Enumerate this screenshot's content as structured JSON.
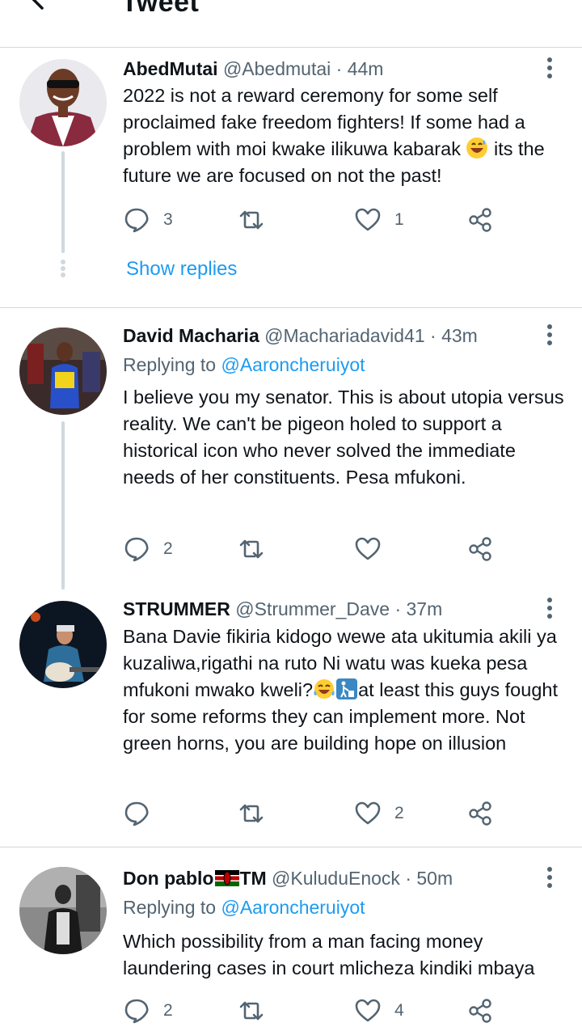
{
  "header": {
    "title": "Tweet",
    "back_icon": "arrow-left-icon"
  },
  "colors": {
    "link": "#1d9bf0",
    "secondary": "#536471",
    "divider": "#cfd9de"
  },
  "tweets": [
    {
      "name": "AbedMutai",
      "handle": "@Abedmutai",
      "time": "· 44m",
      "reply_prefix": "",
      "reply_mention": "",
      "text_parts": [
        "2022 is not a reward ceremony for some self proclaimed fake freedom fighters! If some had a problem with moi kwake ilikuwa kabarak ",
        " its the future we are focused on not the past!"
      ],
      "replies": "3",
      "retweets": "",
      "likes": "1",
      "show_replies": "Show replies"
    },
    {
      "name": "David Macharia",
      "handle": "@Machariadavid41",
      "time": "· 43m",
      "reply_prefix": "Replying to ",
      "reply_mention": "@Aaroncheruiyot",
      "text": "I believe you my senator. This is about utopia versus reality. We can't be pigeon holed to support a historical icon who never solved the immediate needs of her constituents. Pesa mfukoni.",
      "replies": "2",
      "retweets": "",
      "likes": ""
    },
    {
      "name": "STRUMMER",
      "handle": "@Strummer_Dave",
      "time": "· 37m",
      "text_parts": [
        "Bana Davie fikiria kidogo wewe ata ukitumia akili ya kuzaliwa,rigathi na ruto Ni watu was kueka pesa mfukoni mwako kweli?",
        "at least this guys fought for some reforms they can implement more. Not green horns, you are building hope on illusion"
      ],
      "replies": "",
      "retweets": "",
      "likes": "2"
    },
    {
      "name": "Don pablo",
      "name_suffix": "TM",
      "handle": "@KuluduEnock",
      "time": "· 50m",
      "reply_prefix": "Replying to ",
      "reply_mention": "@Aaroncheruiyot",
      "text": "Which possibility from a man facing money laundering cases in court mlicheza kindiki mbaya",
      "replies": "2",
      "retweets": "",
      "likes": "4"
    }
  ]
}
